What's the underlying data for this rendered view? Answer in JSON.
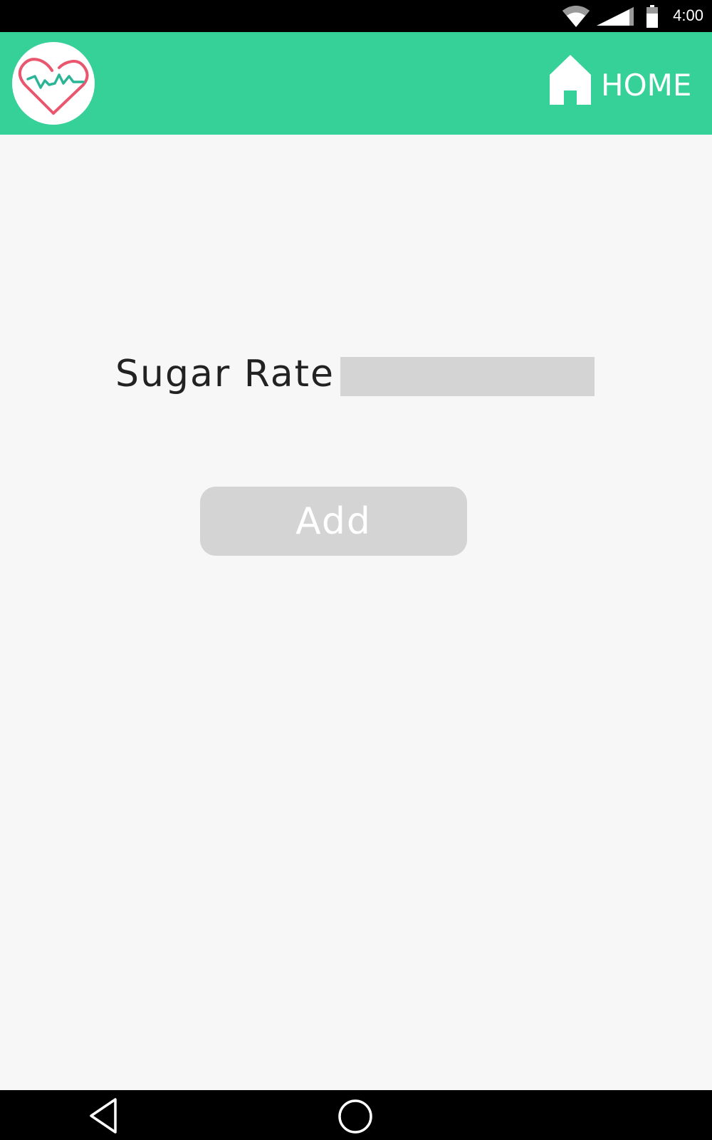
{
  "status_bar": {
    "time": "4:00",
    "icons": [
      "wifi-icon",
      "cellular-signal-icon",
      "battery-icon"
    ]
  },
  "app_bar": {
    "logo_icon": "heart-pulse-logo",
    "home_label": "HOME",
    "home_icon": "house-icon",
    "background_color": "#36d199"
  },
  "form": {
    "label": "Sugar Rate",
    "input_value": "",
    "input_placeholder": "",
    "add_label": "Add"
  },
  "nav_bar": {
    "icons": [
      "back-icon",
      "home-circle-icon"
    ]
  }
}
